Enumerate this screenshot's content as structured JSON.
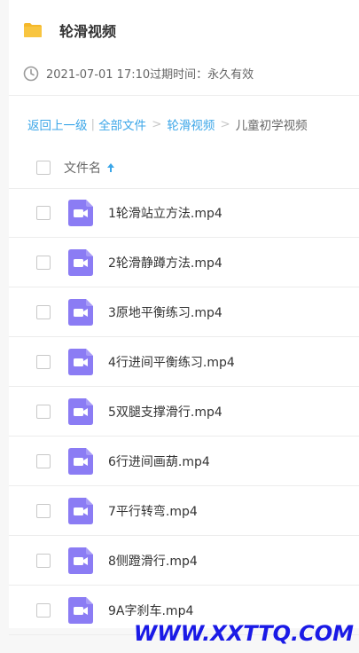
{
  "share": {
    "title": "轮滑视频",
    "folder_icon": "folder-icon",
    "folder_color": "#f5b82a",
    "expire_text": "2021-07-01 17:10过期时间：永久有效"
  },
  "breadcrumb": {
    "back": "返回上一级",
    "all_files": "全部文件",
    "parent": "轮滑视频",
    "current": "儿童初学视频",
    "link_color": "#3ba6e8"
  },
  "list": {
    "column_name": "文件名",
    "sort_icon": "arrow-up-icon",
    "files": [
      {
        "name": "1轮滑站立方法.mp4",
        "icon": "video-file-icon"
      },
      {
        "name": "2轮滑静蹲方法.mp4",
        "icon": "video-file-icon"
      },
      {
        "name": "3原地平衡练习.mp4",
        "icon": "video-file-icon"
      },
      {
        "name": "4行进间平衡练习.mp4",
        "icon": "video-file-icon"
      },
      {
        "name": "5双腿支撑滑行.mp4",
        "icon": "video-file-icon"
      },
      {
        "name": "6行进间画葫.mp4",
        "icon": "video-file-icon"
      },
      {
        "name": "7平行转弯.mp4",
        "icon": "video-file-icon"
      },
      {
        "name": "8侧蹬滑行.mp4",
        "icon": "video-file-icon"
      },
      {
        "name": "9A字刹车.mp4",
        "icon": "video-file-icon"
      }
    ],
    "video_icon_color": "#8b7cf4"
  },
  "watermark": "WWW.XXTTQ.COM"
}
